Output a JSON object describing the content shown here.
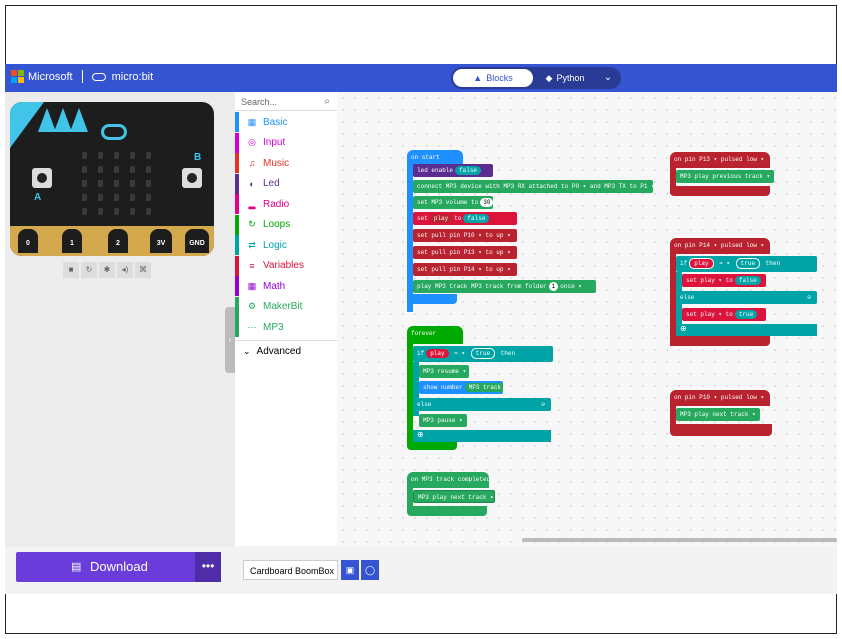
{
  "header": {
    "microsoft_label": "Microsoft",
    "microbit_label": "micro:bit",
    "tab_blocks": "Blocks",
    "tab_python": "Python"
  },
  "simulator": {
    "pins": [
      "0",
      "1",
      "2",
      "3V",
      "GND"
    ],
    "button_a": "A",
    "button_b": "B"
  },
  "toolbox": {
    "search_placeholder": "Search...",
    "categories": [
      {
        "label": "Basic",
        "color": "#1e90ff",
        "icon": "grid-icon"
      },
      {
        "label": "Input",
        "color": "#d400d4",
        "icon": "target-icon"
      },
      {
        "label": "Music",
        "color": "#e63022",
        "icon": "headphones-icon"
      },
      {
        "label": "Led",
        "color": "#5c2d91",
        "icon": "toggle-icon"
      },
      {
        "label": "Radio",
        "color": "#e3008c",
        "icon": "signal-icon"
      },
      {
        "label": "Loops",
        "color": "#00aa00",
        "icon": "refresh-icon"
      },
      {
        "label": "Logic",
        "color": "#00a4a6",
        "icon": "shuffle-icon"
      },
      {
        "label": "Variables",
        "color": "#dc143c",
        "icon": "list-icon"
      },
      {
        "label": "Math",
        "color": "#9400d3",
        "icon": "calculator-icon"
      },
      {
        "label": "MakerBit",
        "color": "#27a85f",
        "icon": "gear-icon"
      },
      {
        "label": "MP3",
        "color": "#27a85f",
        "icon": "dots-icon"
      }
    ],
    "advanced": "Advanced"
  },
  "blocks": {
    "on_start": "on start",
    "led_enable": "led enable",
    "false": "false",
    "true": "true",
    "connect": "connect MP3 device with MP3 RX attached to",
    "p0": "P0",
    "and_tx": "and MP3 TX to",
    "p1": "P1",
    "set_volume": "set MP3 volume to",
    "volume_value": "30",
    "set": "set",
    "play": "play",
    "to": "to",
    "set_pull_pin": "set pull pin",
    "p10": "P10",
    "p13": "P13",
    "p14": "P14",
    "up": "up",
    "play_mp3_track": "play MP3 track",
    "mp3_track": "MP3 track",
    "from_folder": "from folder",
    "folder_value": "1",
    "once": "once",
    "forever": "forever",
    "if": "if",
    "eq": "=",
    "then": "then",
    "else": "else",
    "mp3": "MP3",
    "resume": "resume",
    "pause": "pause",
    "show_number": "show number",
    "on_track_completed": "on MP3 track completed",
    "play_next_track": "play next track",
    "play_previous_track": "play previous track",
    "on_pin": "on pin",
    "pulsed": "pulsed",
    "low": "low"
  },
  "footer": {
    "download_label": "Download",
    "more_label": "•••",
    "project_name": "Cardboard BoomBox C"
  },
  "colors": {
    "mp3_green": "#27a85f",
    "loops_green": "#00aa00",
    "variables_red": "#dc143c",
    "logic_teal": "#00a4a6",
    "event_blue": "#1e90ff",
    "pins_red": "#b8232f",
    "led_purple": "#5c2d91"
  }
}
